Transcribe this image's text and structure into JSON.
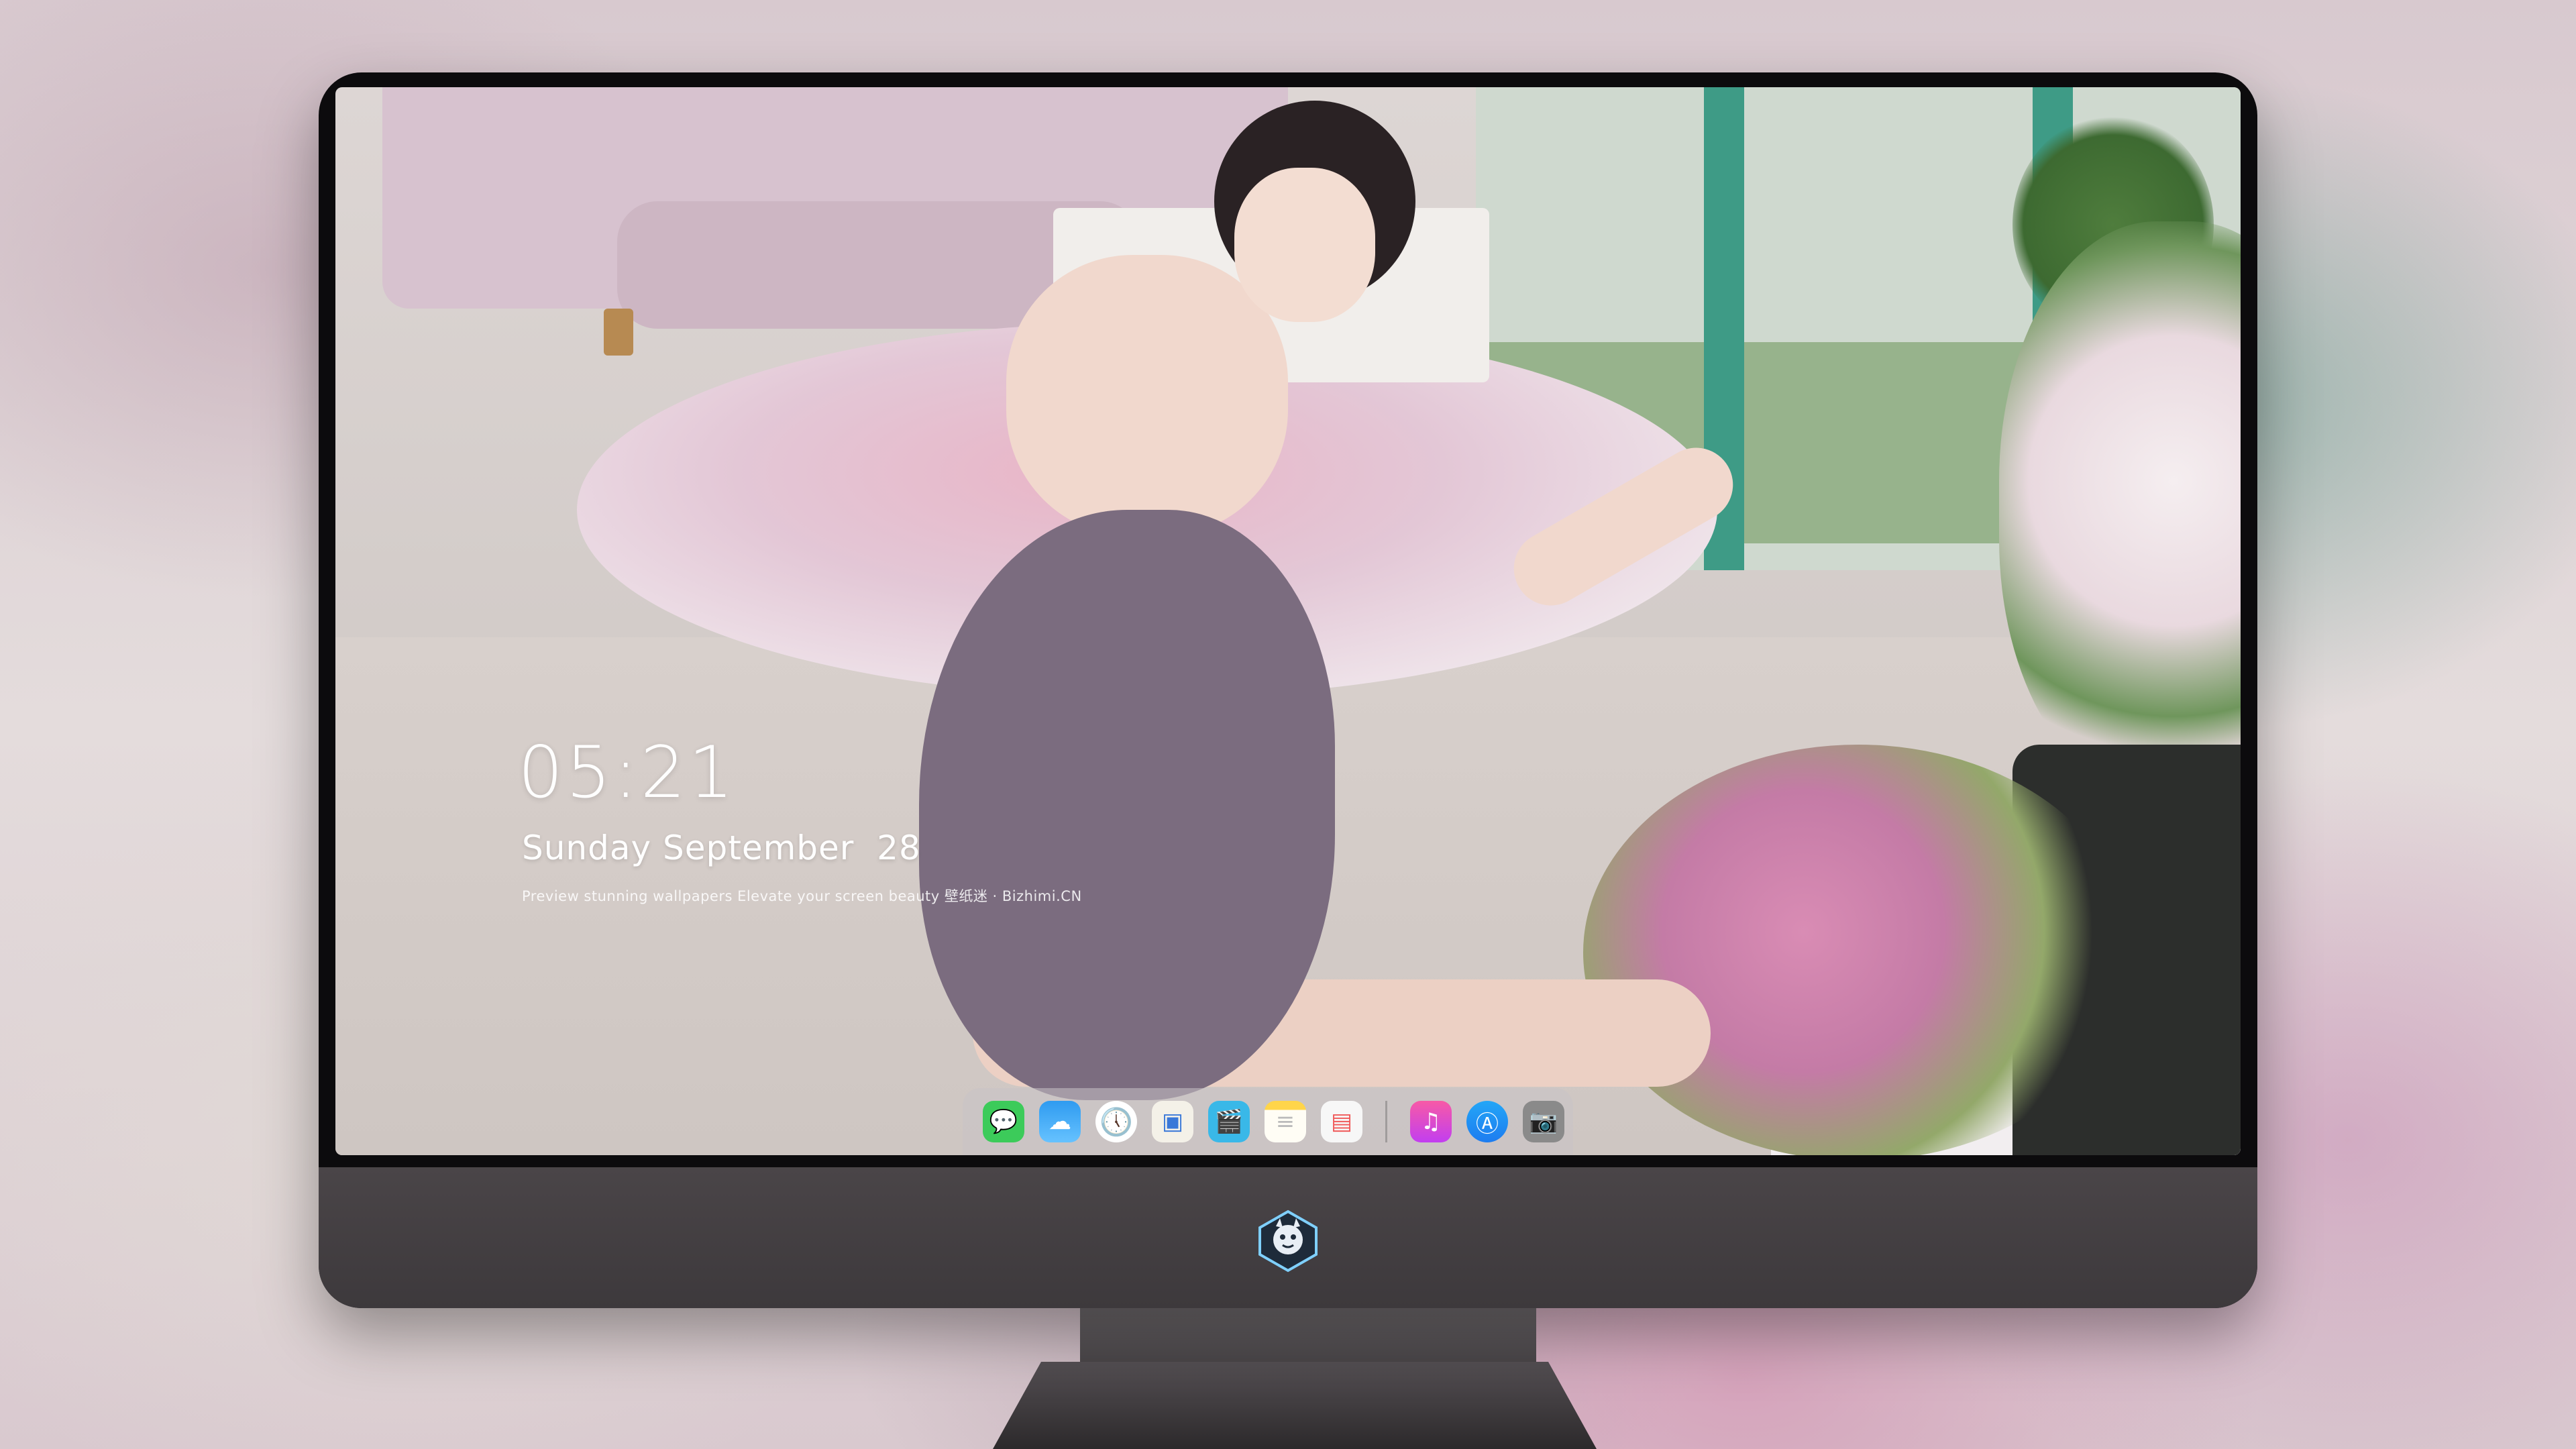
{
  "lock_screen": {
    "time": "05:21",
    "date": "Sunday September  28",
    "caption": "Preview stunning wallpapers  Elevate your screen beauty  壁纸迷 · Bizhimi.CN"
  },
  "dock": {
    "apps": [
      {
        "name": "Messages",
        "icon": "message-bubble-icon",
        "glyph": "💬"
      },
      {
        "name": "Weather",
        "icon": "weather-cloud-icon",
        "glyph": "☁"
      },
      {
        "name": "Clock",
        "icon": "clock-icon",
        "glyph": "🕔"
      },
      {
        "name": "Preview",
        "icon": "preview-icon",
        "glyph": "▣"
      },
      {
        "name": "Claquette",
        "icon": "clapperboard-icon",
        "glyph": "🎬"
      },
      {
        "name": "Notes",
        "icon": "notes-icon",
        "glyph": "≡"
      },
      {
        "name": "Photos",
        "icon": "photos-icon",
        "glyph": "▤"
      },
      {
        "name": "Music",
        "icon": "music-note-icon",
        "glyph": "♫"
      },
      {
        "name": "App Store",
        "icon": "app-store-icon",
        "glyph": "Ⓐ"
      },
      {
        "name": "Camera",
        "icon": "camera-icon",
        "glyph": "📷"
      }
    ]
  },
  "monitor": {
    "logo_icon": "dragon-mascot-logo-icon"
  },
  "colors": {
    "monitor_bezel": "#0c0b0d",
    "monitor_chin": "#443f42",
    "dock_background": "rgba(200,195,198,0.55)",
    "clock_text": "#ffffff"
  }
}
